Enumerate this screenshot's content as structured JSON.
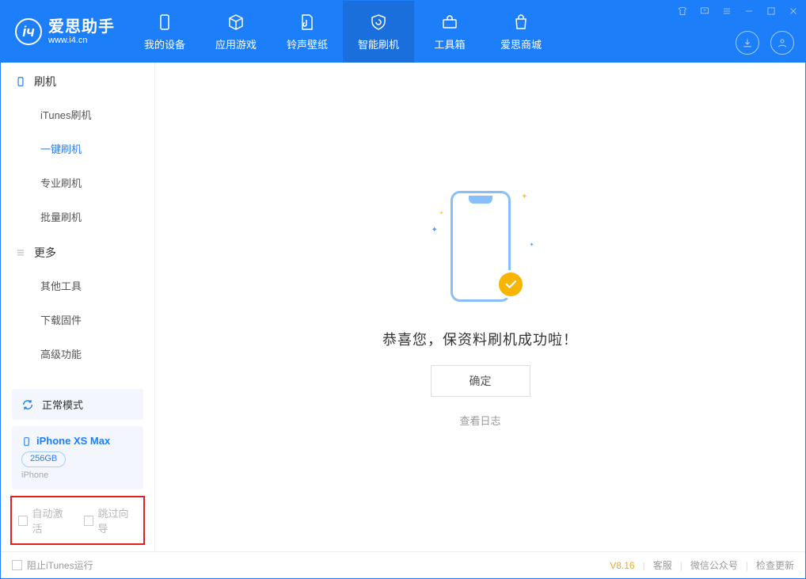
{
  "header": {
    "app_name": "爱思助手",
    "site": "www.i4.cn",
    "nav": [
      {
        "label": "我的设备"
      },
      {
        "label": "应用游戏"
      },
      {
        "label": "铃声壁纸"
      },
      {
        "label": "智能刷机"
      },
      {
        "label": "工具箱"
      },
      {
        "label": "爱思商城"
      }
    ]
  },
  "sidebar": {
    "section1": {
      "title": "刷机",
      "items": [
        {
          "label": "iTunes刷机"
        },
        {
          "label": "一键刷机"
        },
        {
          "label": "专业刷机"
        },
        {
          "label": "批量刷机"
        }
      ]
    },
    "section2": {
      "title": "更多",
      "items": [
        {
          "label": "其他工具"
        },
        {
          "label": "下载固件"
        },
        {
          "label": "高级功能"
        }
      ]
    },
    "mode": "正常模式",
    "device": {
      "name": "iPhone XS Max",
      "capacity": "256GB",
      "type": "iPhone"
    },
    "opt_auto_activate": "自动激活",
    "opt_skip_guide": "跳过向导"
  },
  "main": {
    "success_text": "恭喜您，保资料刷机成功啦！",
    "ok_label": "确定",
    "log_link": "查看日志"
  },
  "footer": {
    "block_itunes": "阻止iTunes运行",
    "version": "V8.16",
    "support": "客服",
    "wechat": "微信公众号",
    "check_update": "检查更新"
  }
}
